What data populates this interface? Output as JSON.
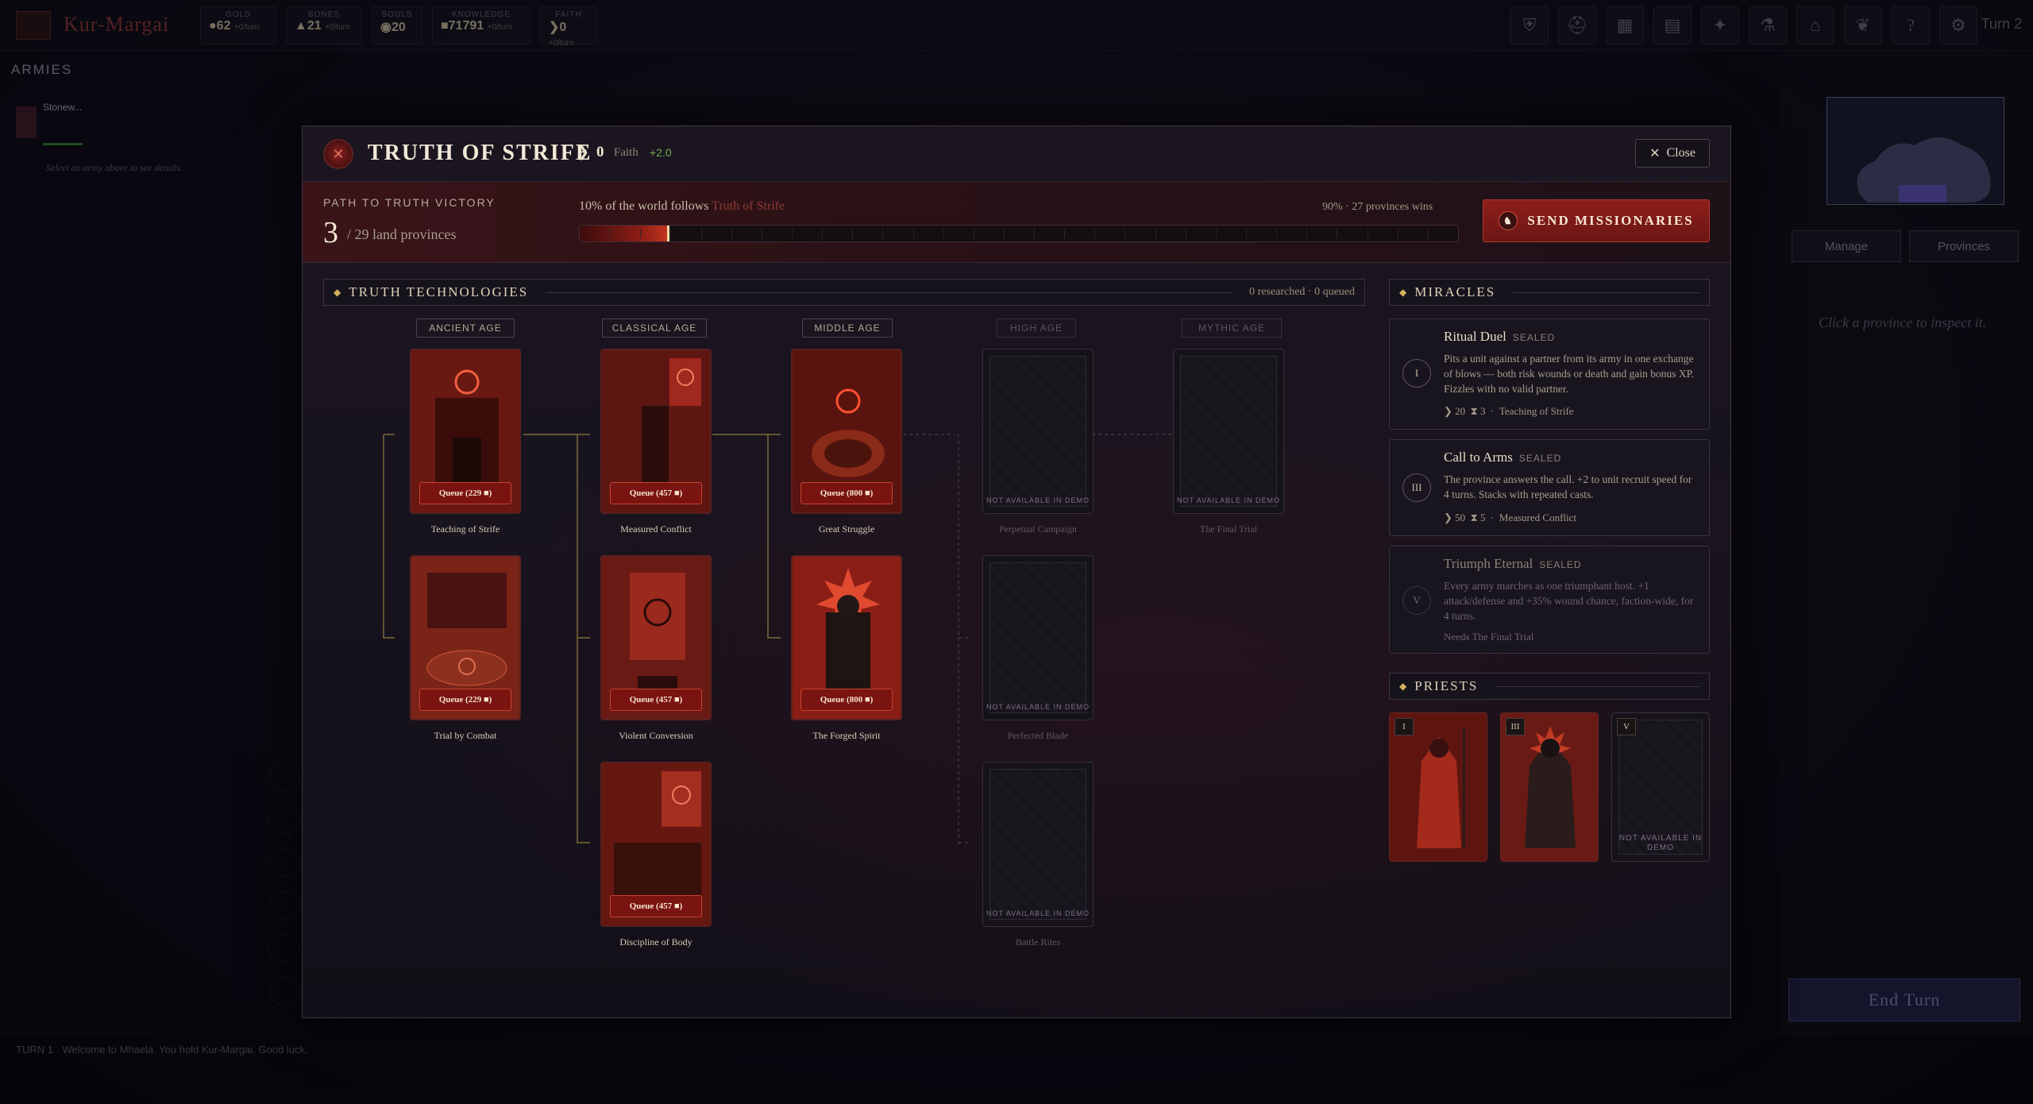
{
  "topbar": {
    "game_title": "Kur-Margai",
    "resources": [
      {
        "label": "GOLD",
        "value": "62",
        "rate": "+0/turn"
      },
      {
        "label": "BONES",
        "value": "21",
        "rate": "+0/turn"
      },
      {
        "label": "SOULS",
        "value": "20",
        "rate": ""
      },
      {
        "label": "KNOWLEDGE",
        "value": "71791",
        "rate": "+0/turn"
      },
      {
        "label": "FAITH",
        "value": "0",
        "rate": "+0/turn"
      }
    ],
    "turn": "Turn 2"
  },
  "left_panel": {
    "title": "ARMIES",
    "army_name": "Stonew...",
    "hint": "Select an army above to see details."
  },
  "right_panel": {
    "tab_manage": "Manage",
    "tab_provinces": "Provinces",
    "hint": "Click a province to inspect it.",
    "end_turn": "End Turn"
  },
  "status_bar": "TURN 1 · Welcome to Mhaela. You hold Kur-Margai. Good luck.",
  "modal": {
    "title": "TRUTH OF STRIFE",
    "faith_value": "0",
    "faith_label": "Faith",
    "faith_delta": "+2.0",
    "close_label": "Close",
    "path_label": "PATH TO TRUTH VICTORY",
    "path_count": "3",
    "path_total": "/ 29 land provinces",
    "world_prefix": "10% of the world follows",
    "world_truth": "Truth of Strife",
    "wins_label": "90% · 27 provinces wins",
    "world_follow_fraction": 0.1,
    "wins_threshold_fraction": 0.9,
    "send_label": "SEND MISSIONARIES",
    "tech_title": "TRUTH TECHNOLOGIES",
    "tech_meta": "0 researched · 0 queued",
    "ages": [
      "ANCIENT AGE",
      "CLASSICAL AGE",
      "MIDDLE AGE",
      "HIGH AGE",
      "MYTHIC AGE"
    ],
    "techs": {
      "teaching": {
        "name": "Teaching of Strife",
        "queue": "Queue (229 ■)"
      },
      "trial": {
        "name": "Trial by Combat",
        "queue": "Queue (229 ■)"
      },
      "measured": {
        "name": "Measured Conflict",
        "queue": "Queue (457 ■)"
      },
      "violent": {
        "name": "Violent Conversion",
        "queue": "Queue (457 ■)"
      },
      "discipline": {
        "name": "Discipline of Body",
        "queue": "Queue (457 ■)"
      },
      "great": {
        "name": "Great Struggle",
        "queue": "Queue (800 ■)"
      },
      "forged": {
        "name": "The Forged Spirit",
        "queue": "Queue (800 ■)"
      },
      "perpetual": {
        "name": "Perpetual Campaign",
        "locked": "NOT AVAILABLE IN DEMO"
      },
      "perfected": {
        "name": "Perfected Blade",
        "locked": "NOT AVAILABLE IN DEMO"
      },
      "battle": {
        "name": "Battle Rites",
        "locked": "NOT AVAILABLE IN DEMO"
      },
      "final": {
        "name": "The Final Trial",
        "locked": "NOT AVAILABLE IN DEMO"
      }
    },
    "miracles_title": "MIRACLES",
    "miracles": [
      {
        "num": "I",
        "title": "Ritual Duel",
        "seal": "SEALED",
        "desc": "Pits a unit against a partner from its army in one exchange of blows — both risk wounds or death and gain bonus XP. Fizzles with no valid partner.",
        "faith": "20",
        "turns": "3",
        "req": "Teaching of Strife"
      },
      {
        "num": "III",
        "title": "Call to Arms",
        "seal": "SEALED",
        "desc": "The province answers the call. +2 to unit recruit speed for 4 turns. Stacks with repeated casts.",
        "faith": "50",
        "turns": "5",
        "req": "Measured Conflict"
      },
      {
        "num": "V",
        "title": "Triumph Eternal",
        "seal": "SEALED",
        "desc": "Every army marches as one triumphant host. +1 attack/defense and +35% wound chance, faction-wide, for 4 turns.",
        "req": "Needs The Final Trial"
      }
    ],
    "priests_title": "PRIESTS",
    "priests": [
      {
        "num": "I"
      },
      {
        "num": "III"
      },
      {
        "num": "V",
        "locked": "NOT AVAILABLE IN DEMO"
      }
    ]
  }
}
